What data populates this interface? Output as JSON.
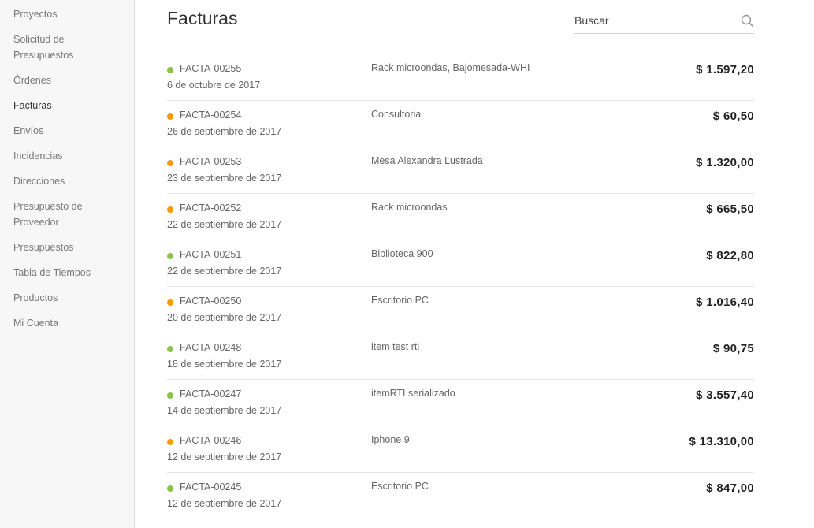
{
  "colors": {
    "status_paid": "#8bc34a",
    "status_pending": "#ff9800"
  },
  "sidebar": {
    "items": [
      {
        "label": "Proyectos"
      },
      {
        "label": "Solicitud de Presupuestos"
      },
      {
        "label": "Órdenes"
      },
      {
        "label": "Facturas"
      },
      {
        "label": "Envíos"
      },
      {
        "label": "Incidencias"
      },
      {
        "label": "Direcciones"
      },
      {
        "label": "Presupuesto de Proveedor"
      },
      {
        "label": "Presupuestos"
      },
      {
        "label": "Tabla de Tiempos"
      },
      {
        "label": "Productos"
      },
      {
        "label": "Mi Cuenta"
      }
    ],
    "active_index": 3
  },
  "header": {
    "title": "Facturas"
  },
  "search": {
    "placeholder": "Buscar",
    "icon": "search-icon"
  },
  "invoices": [
    {
      "code": "FACTA-00255",
      "date": "6 de octubre de 2017",
      "description": "Rack microondas, Bajomesada-WHI",
      "amount": "$ 1.597,20",
      "status": "paid"
    },
    {
      "code": "FACTA-00254",
      "date": "26 de septiembre de 2017",
      "description": "Consultoria",
      "amount": "$ 60,50",
      "status": "pending"
    },
    {
      "code": "FACTA-00253",
      "date": "23 de septiembre de 2017",
      "description": "Mesa Alexandra Lustrada",
      "amount": "$ 1.320,00",
      "status": "pending"
    },
    {
      "code": "FACTA-00252",
      "date": "22 de septiembre de 2017",
      "description": "Rack microondas",
      "amount": "$ 665,50",
      "status": "pending"
    },
    {
      "code": "FACTA-00251",
      "date": "22 de septiembre de 2017",
      "description": "Biblioteca 900",
      "amount": "$ 822,80",
      "status": "paid"
    },
    {
      "code": "FACTA-00250",
      "date": "20 de septiembre de 2017",
      "description": "Escritorio PC",
      "amount": "$ 1.016,40",
      "status": "pending"
    },
    {
      "code": "FACTA-00248",
      "date": "18 de septiembre de 2017",
      "description": "item test rti",
      "amount": "$ 90,75",
      "status": "paid"
    },
    {
      "code": "FACTA-00247",
      "date": "14 de septiembre de 2017",
      "description": "itemRTI serializado",
      "amount": "$ 3.557,40",
      "status": "paid"
    },
    {
      "code": "FACTA-00246",
      "date": "12 de septiembre de 2017",
      "description": "Iphone 9",
      "amount": "$ 13.310,00",
      "status": "pending"
    },
    {
      "code": "FACTA-00245",
      "date": "12 de septiembre de 2017",
      "description": "Escritorio PC",
      "amount": "$ 847,00",
      "status": "paid"
    }
  ]
}
